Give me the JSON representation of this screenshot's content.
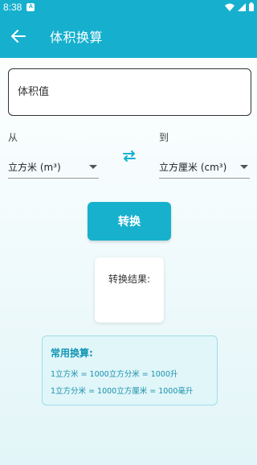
{
  "status_bar": {
    "time": "8:38",
    "notification_icon": "a-box-icon"
  },
  "app_bar": {
    "title": "体积换算"
  },
  "input": {
    "placeholder": "体积值",
    "value": ""
  },
  "from": {
    "label": "从",
    "selected": "立方米 (m³)"
  },
  "to": {
    "label": "到",
    "selected": "立方厘米 (cm³)"
  },
  "convert_button": {
    "label": "转换"
  },
  "result": {
    "label": "转换结果:"
  },
  "info": {
    "title": "常用换算:",
    "lines": [
      "1立方米 = 1000立方分米 = 1000升",
      "1立方分米 = 1000立方厘米 = 1000毫升"
    ]
  },
  "colors": {
    "primary": "#16b0ce",
    "button": "#17b1cd",
    "info_bg": "#e0f6f9",
    "info_text": "#1a8fad"
  }
}
